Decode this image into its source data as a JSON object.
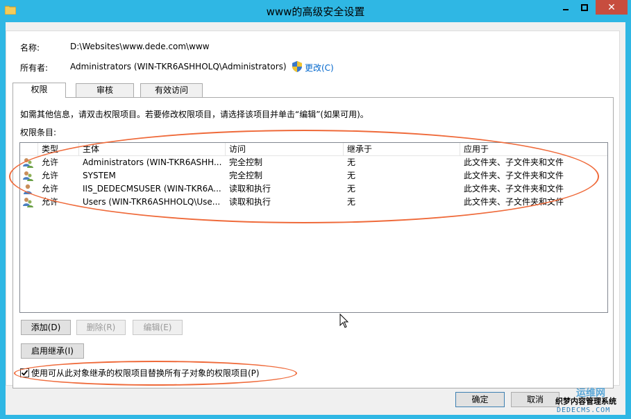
{
  "window": {
    "title": "www的高级安全设置"
  },
  "fields": {
    "name_label": "名称:",
    "name_value": "D:\\Websites\\www.dede.com\\www",
    "owner_label": "所有者:",
    "owner_value": "Administrators (WIN-TKR6ASHHOLQ\\Administrators)",
    "change_link": "更改(C)"
  },
  "tabs": [
    {
      "label": "权限"
    },
    {
      "label": "审核"
    },
    {
      "label": "有效访问"
    }
  ],
  "info_text": "如需其他信息，请双击权限项目。若要修改权限项目，请选择该项目并单击“编辑”(如果可用)。",
  "entries_label": "权限条目:",
  "columns": [
    "类型",
    "主体",
    "访问",
    "继承于",
    "应用于"
  ],
  "rows": [
    {
      "type": "允许",
      "principal": "Administrators (WIN-TKR6ASHH...",
      "access": "完全控制",
      "inherited": "无",
      "applies": "此文件夹、子文件夹和文件"
    },
    {
      "type": "允许",
      "principal": "SYSTEM",
      "access": "完全控制",
      "inherited": "无",
      "applies": "此文件夹、子文件夹和文件"
    },
    {
      "type": "允许",
      "principal": "IIS_DEDECMSUSER (WIN-TKR6A...",
      "access": "读取和执行",
      "inherited": "无",
      "applies": "此文件夹、子文件夹和文件"
    },
    {
      "type": "允许",
      "principal": "Users (WIN-TKR6ASHHOLQ\\Use...",
      "access": "读取和执行",
      "inherited": "无",
      "applies": "此文件夹、子文件夹和文件"
    }
  ],
  "buttons": {
    "add": "添加(D)",
    "remove": "删除(R)",
    "edit": "编辑(E)",
    "enable_inheritance": "启用继承(I)",
    "ok": "确定",
    "cancel": "取消"
  },
  "checkbox": {
    "label": "使用可从此对象继承的权限项目替换所有子对象的权限项目(P)",
    "checked": true
  },
  "watermark": {
    "line1": "运维网",
    "line2": "织梦内容管理系统",
    "line3": "DEDECMS.COM"
  },
  "colors": {
    "titlebar": "#2fb7e4",
    "close": "#c74d3e",
    "annotation": "#ef6a3a",
    "link": "#0066cc"
  }
}
